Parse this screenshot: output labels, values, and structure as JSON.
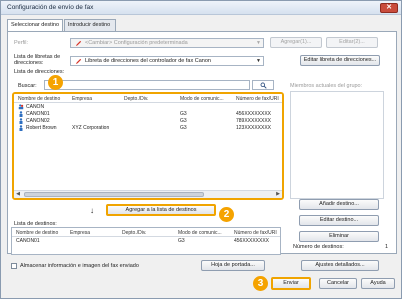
{
  "window": {
    "title": "Configuración de envío de fax",
    "close_glyph": "✕"
  },
  "tabs": [
    {
      "label": "Seleccionar destino"
    },
    {
      "label": "Introducir destino"
    }
  ],
  "profile": {
    "label": "Perfil:",
    "value": "<Cambiar> Configuración predeterminada",
    "add_button": "Agregar(1)...",
    "edit_button": "Editar(2)..."
  },
  "address_book": {
    "label": "Lista de libretas de direcciones:",
    "value": "Libreta de direcciones del controlador de fax Canon",
    "edit_button": "Editar libreta de direcciones..."
  },
  "directory": {
    "label": "Lista de direcciones:",
    "search_label": "Buscar:",
    "search_value": ""
  },
  "group_members_label": "Miembros actuales del grupo:",
  "address_table": {
    "columns": [
      "Nombre de destino",
      "Empresa",
      "Depto./Div.",
      "Modo de comunic...",
      "Número de fax/URI"
    ],
    "rows": [
      {
        "icon": "group-icon",
        "name": "CANON",
        "company": "",
        "dept": "",
        "mode": "",
        "fax": ""
      },
      {
        "icon": "person-icon",
        "name": "CANON01",
        "company": "",
        "dept": "",
        "mode": "G3",
        "fax": "456XXXXXXXX"
      },
      {
        "icon": "person-icon",
        "name": "CANON02",
        "company": "",
        "dept": "",
        "mode": "G3",
        "fax": "789XXXXXXXX"
      },
      {
        "icon": "person-icon",
        "name": "Robert Brown",
        "company": "XYZ Corporation",
        "dept": "",
        "mode": "G3",
        "fax": "123XXXXXXXX"
      }
    ]
  },
  "add_to_list_button": "Agregar a la lista de destinos",
  "destinations": {
    "label": "Lista de destinos:",
    "columns": [
      "Nombre de destino",
      "Empresa",
      "Depto./Div.",
      "Modo de comunic...",
      "Número de fax/URI"
    ],
    "rows": [
      {
        "name": "CANON01",
        "company": "",
        "dept": "",
        "mode": "G3",
        "fax": "456XXXXXXXX"
      }
    ],
    "add_button": "Añadir destino...",
    "edit_button": "Editar destino...",
    "delete_button": "Eliminar",
    "count_label": "Número de destinos:",
    "count_value": "1"
  },
  "store_checkbox_label": "Almacenar información e imagen del fax enviado",
  "cover_page_button": "Hoja de portada...",
  "details_button": "Ajustes detallados...",
  "footer": {
    "send_button": "Enviar",
    "cancel_button": "Cancelar",
    "help_button": "Ayuda"
  },
  "badges": [
    "1",
    "2",
    "3"
  ],
  "colors": {
    "highlight": "#f5a300",
    "pen_red": "#d8352a",
    "person_blue": "#2f6fc0"
  }
}
